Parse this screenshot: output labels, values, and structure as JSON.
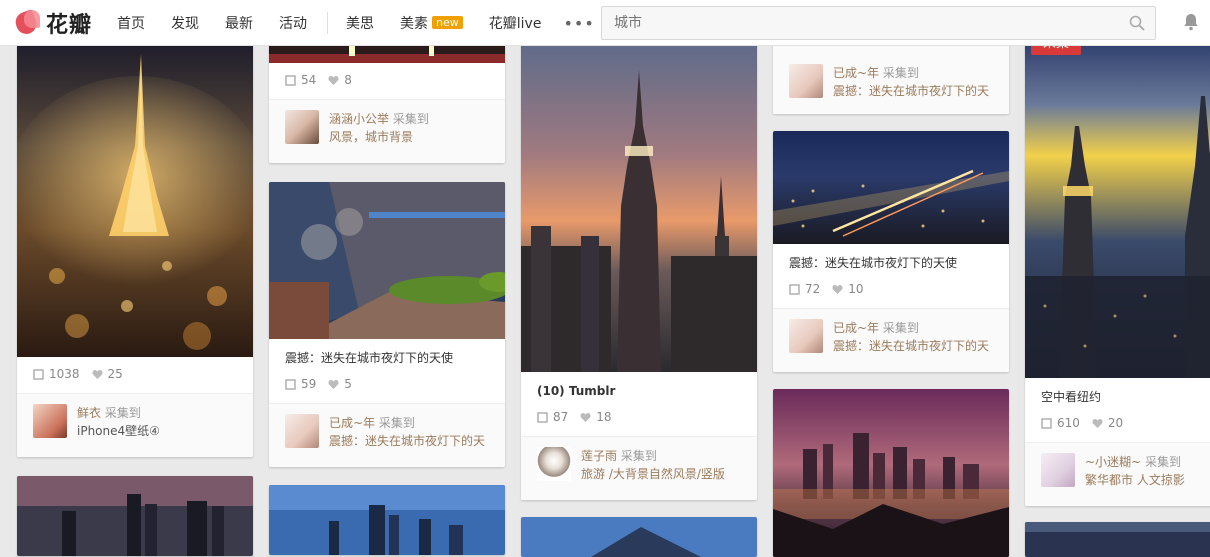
{
  "logo": {
    "text": "花瓣"
  },
  "nav": {
    "items": [
      "首页",
      "发现",
      "最新",
      "活动"
    ],
    "items2": [
      "美思",
      "美素",
      "花瓣live"
    ],
    "new_badge": "new",
    "more": "•••"
  },
  "search": {
    "placeholder": "城市"
  },
  "colors": {
    "accent": "#e54f5c",
    "badge": "#f2a000",
    "link": "#9b7b5c",
    "button": "#d83a3a"
  },
  "pins": [
    {
      "stats": {
        "repins": "1038",
        "likes": "25"
      },
      "via": {
        "user": "鲜衣",
        "action": "采集到",
        "board": "iPhone4壁纸④"
      }
    },
    {
      "stats": {
        "repins": "54",
        "likes": "8"
      },
      "via": {
        "user": "涵涵小公举",
        "action": "采集到",
        "board": "风景，城市背景"
      }
    },
    {
      "desc": "震撼：迷失在城市夜灯下的天使",
      "stats": {
        "repins": "59",
        "likes": "5"
      },
      "via": {
        "user": "已成~年",
        "action": "采集到",
        "board": "震撼：迷失在城市夜灯下的天"
      }
    },
    {
      "desc": "(10) Tumblr",
      "stats": {
        "repins": "87",
        "likes": "18"
      },
      "via": {
        "user": "莲子雨",
        "action": "采集到",
        "board": "旅游 /大背景自然风景/竖版"
      }
    },
    {
      "via": {
        "user": "已成~年",
        "action": "采集到",
        "board": "震撼：迷失在城市夜灯下的天"
      }
    },
    {
      "desc": "震撼：迷失在城市夜灯下的天使",
      "stats": {
        "repins": "72",
        "likes": "10"
      },
      "via": {
        "user": "已成~年",
        "action": "采集到",
        "board": "震撼：迷失在城市夜灯下的天"
      }
    },
    {
      "desc": "空中看纽约",
      "stats": {
        "repins": "610",
        "likes": "20"
      },
      "via": {
        "user": "~小迷糊~",
        "action": "采集到",
        "board": "繁华都市 人文掠影"
      }
    }
  ],
  "collect_button": "采集"
}
